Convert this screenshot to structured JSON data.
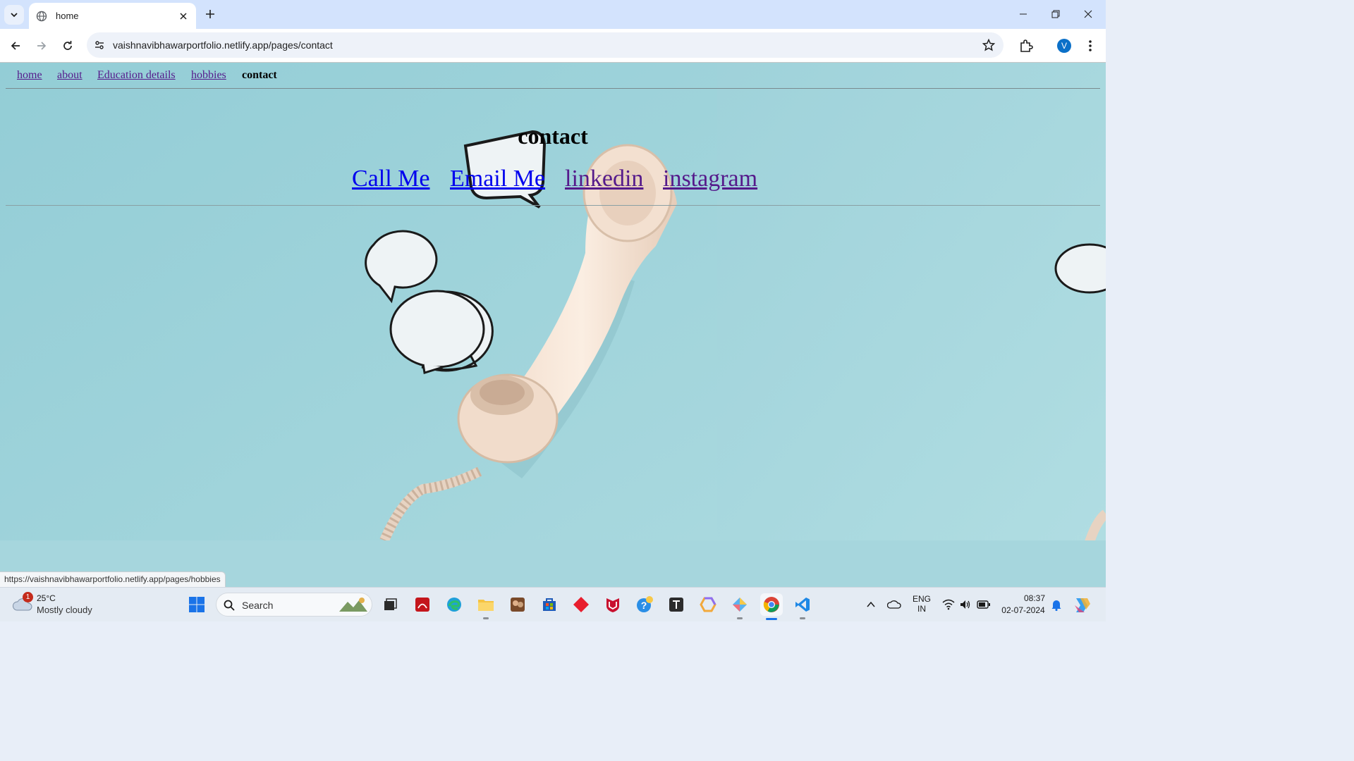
{
  "browser": {
    "tab_title": "home",
    "url": "vaishnavibhawarportfolio.netlify.app/pages/contact",
    "profile_initial": "V",
    "status_url": "https://vaishnavibhawarportfolio.netlify.app/pages/hobbies"
  },
  "site": {
    "nav": [
      {
        "label": "home"
      },
      {
        "label": "about"
      },
      {
        "label": "Education details"
      },
      {
        "label": "hobbies"
      },
      {
        "label": "contact"
      }
    ],
    "heading": "contact",
    "contact_links": [
      {
        "label": "Call Me"
      },
      {
        "label": "Email Me"
      },
      {
        "label": "linkedin"
      },
      {
        "label": "instagram"
      }
    ],
    "colors": {
      "link": "#0000ee",
      "visited": "#551a8b",
      "background": "#a9d8de"
    }
  },
  "taskbar": {
    "weather": {
      "temp": "25°C",
      "desc": "Mostly cloudy",
      "badge": "1"
    },
    "search_label": "Search",
    "language": {
      "line1": "ENG",
      "line2": "IN"
    },
    "time": "08:37",
    "date": "02-07-2024"
  }
}
